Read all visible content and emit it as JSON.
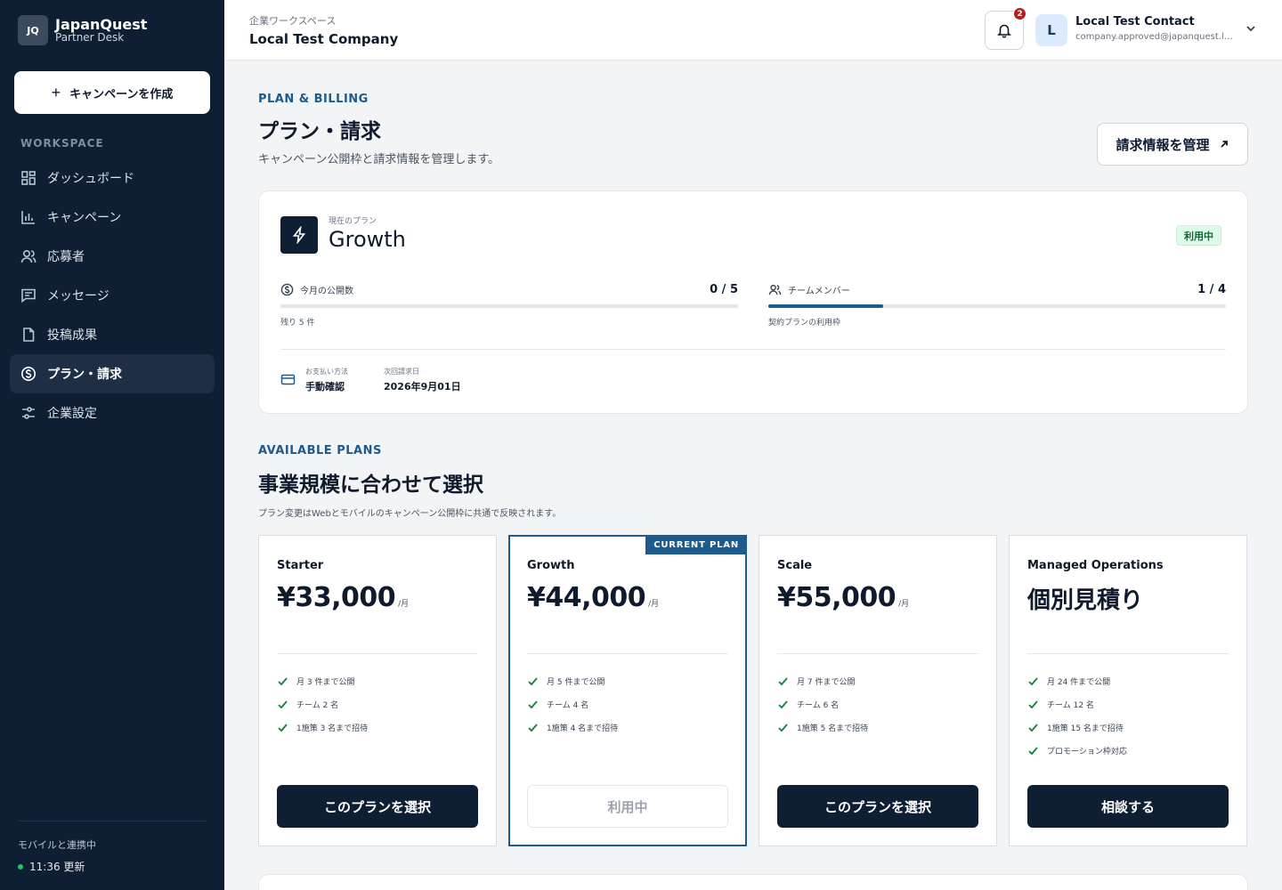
{
  "brand": {
    "logo": "JQ",
    "name": "JapanQuest",
    "sub": "Partner Desk"
  },
  "sidebar": {
    "create_label": "キャンペーンを作成",
    "section_label": "WORKSPACE",
    "items": [
      {
        "label": "ダッシュボード",
        "icon": "grid-icon"
      },
      {
        "label": "キャンペーン",
        "icon": "bar-chart-icon"
      },
      {
        "label": "応募者",
        "icon": "users-icon"
      },
      {
        "label": "メッセージ",
        "icon": "message-icon"
      },
      {
        "label": "投稿成果",
        "icon": "file-icon"
      },
      {
        "label": "プラン・請求",
        "icon": "dollar-icon",
        "active": true
      },
      {
        "label": "企業設定",
        "icon": "sliders-icon"
      }
    ],
    "sync_title": "モバイルと連携中",
    "sync_time": "11:36 更新",
    "sync_color": "#22c55e"
  },
  "header": {
    "workspace_label": "企業ワークスペース",
    "company": "Local Test Company",
    "notification_count": "2",
    "avatar_initial": "L",
    "user_name": "Local Test Contact",
    "user_email": "company.approved@japanquest.local"
  },
  "billing": {
    "eyebrow": "PLAN & BILLING",
    "title": "プラン・請求",
    "description": "キャンペーン公開枠と請求情報を管理します。",
    "manage_label": "請求情報を管理"
  },
  "current_plan": {
    "label": "現在のプラン",
    "name": "Growth",
    "status": "利用中",
    "publish": {
      "label": "今月の公開数",
      "value": "0 / 5",
      "note": "残り 5 件",
      "fraction": 0.0
    },
    "members": {
      "label": "チームメンバー",
      "value": "1 / 4",
      "note": "契約プランの利用枠",
      "fraction": 0.25
    },
    "payment": {
      "label": "お支払い方法",
      "value": "手動確認"
    },
    "next_billing": {
      "label": "次回請求日",
      "value": "2026年9月01日"
    }
  },
  "available": {
    "eyebrow": "AVAILABLE PLANS",
    "title": "事業規模に合わせて選択",
    "description": "プラン変更はWebとモバイルのキャンペーン公開枠に共通で反映されます。",
    "current_badge": "CURRENT PLAN",
    "plans": [
      {
        "name": "Starter",
        "price": "¥33,000",
        "unit": "/月",
        "features": [
          "月 3 件まで公開",
          "チーム 2 名",
          "1施策 3 名まで招待"
        ],
        "button": "このプランを選択"
      },
      {
        "name": "Growth",
        "price": "¥44,000",
        "unit": "/月",
        "features": [
          "月 5 件まで公開",
          "チーム 4 名",
          "1施策 4 名まで招待"
        ],
        "button": "利用中",
        "current": true
      },
      {
        "name": "Scale",
        "price": "¥55,000",
        "unit": "/月",
        "features": [
          "月 7 件まで公開",
          "チーム 6 名",
          "1施策 5 名まで招待"
        ],
        "button": "このプランを選択"
      },
      {
        "name": "Managed Operations",
        "price": "個別見積り",
        "unit": "",
        "features": [
          "月 24 件まで公開",
          "チーム 12 名",
          "1施策 15 名まで招待",
          "プロモーション枠対応"
        ],
        "button": "相談する"
      }
    ]
  },
  "colors": {
    "accent": "#1d5a8e",
    "sidebar": "#0f1f33",
    "success": "#166534",
    "danger": "#b91c1c"
  }
}
